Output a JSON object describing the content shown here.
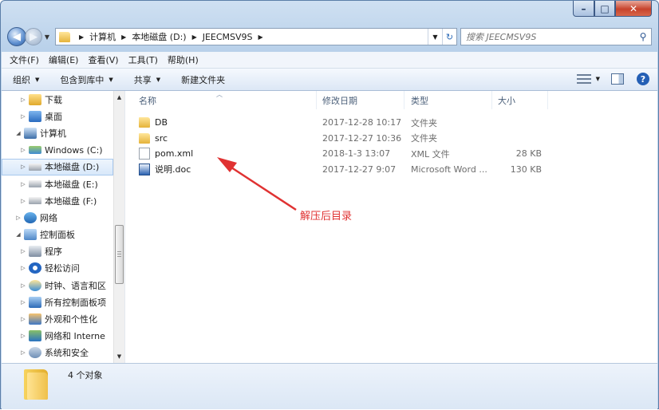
{
  "window": {
    "buttons": {
      "min": "–",
      "max": "□",
      "close": "✕"
    }
  },
  "address": {
    "crumbs": [
      "计算机",
      "本地磁盘 (D:)",
      "JEECMSV9S"
    ],
    "search_placeholder": "搜索 JEECMSV9S"
  },
  "menu": [
    "文件(F)",
    "编辑(E)",
    "查看(V)",
    "工具(T)",
    "帮助(H)"
  ],
  "commands": {
    "organize": "组织",
    "include": "包含到库中",
    "share": "共享",
    "new_folder": "新建文件夹"
  },
  "nav_tree": [
    {
      "label": "下载",
      "icon": "downloads-icon"
    },
    {
      "label": "桌面",
      "icon": "desktop-icon"
    },
    {
      "label": "计算机",
      "icon": "computer-icon"
    },
    {
      "label": "Windows (C:)",
      "icon": "windows-drive-icon"
    },
    {
      "label": "本地磁盘 (D:)",
      "icon": "drive-icon"
    },
    {
      "label": "本地磁盘 (E:)",
      "icon": "drive-icon"
    },
    {
      "label": "本地磁盘 (F:)",
      "icon": "drive-icon"
    },
    {
      "label": "网络",
      "icon": "network-icon"
    },
    {
      "label": "控制面板",
      "icon": "control-panel-icon"
    },
    {
      "label": "程序",
      "icon": "programs-icon"
    },
    {
      "label": "轻松访问",
      "icon": "ease-of-access-icon"
    },
    {
      "label": "时钟、语言和区",
      "icon": "clock-language-icon"
    },
    {
      "label": "所有控制面板项",
      "icon": "all-control-panel-icon"
    },
    {
      "label": "外观和个性化",
      "icon": "appearance-icon"
    },
    {
      "label": "网络和 Interne",
      "icon": "network-internet-icon"
    },
    {
      "label": "系统和安全",
      "icon": "system-security-icon"
    }
  ],
  "columns": {
    "name": "名称",
    "date": "修改日期",
    "type": "类型",
    "size": "大小"
  },
  "files": [
    {
      "name": "DB",
      "date": "2017-12-28 10:17",
      "type": "文件夹",
      "size": "",
      "icon": "folder-icon"
    },
    {
      "name": "src",
      "date": "2017-12-27 10:36",
      "type": "文件夹",
      "size": "",
      "icon": "folder-icon"
    },
    {
      "name": "pom.xml",
      "date": "2018-1-3 13:07",
      "type": "XML 文件",
      "size": "28 KB",
      "icon": "xml-file-icon"
    },
    {
      "name": "说明.doc",
      "date": "2017-12-27 9:07",
      "type": "Microsoft Word ...",
      "size": "130 KB",
      "icon": "word-doc-icon"
    }
  ],
  "annotation": {
    "text": "解压后目录",
    "color": "#e03232"
  },
  "status": {
    "count": "4 个对象"
  }
}
